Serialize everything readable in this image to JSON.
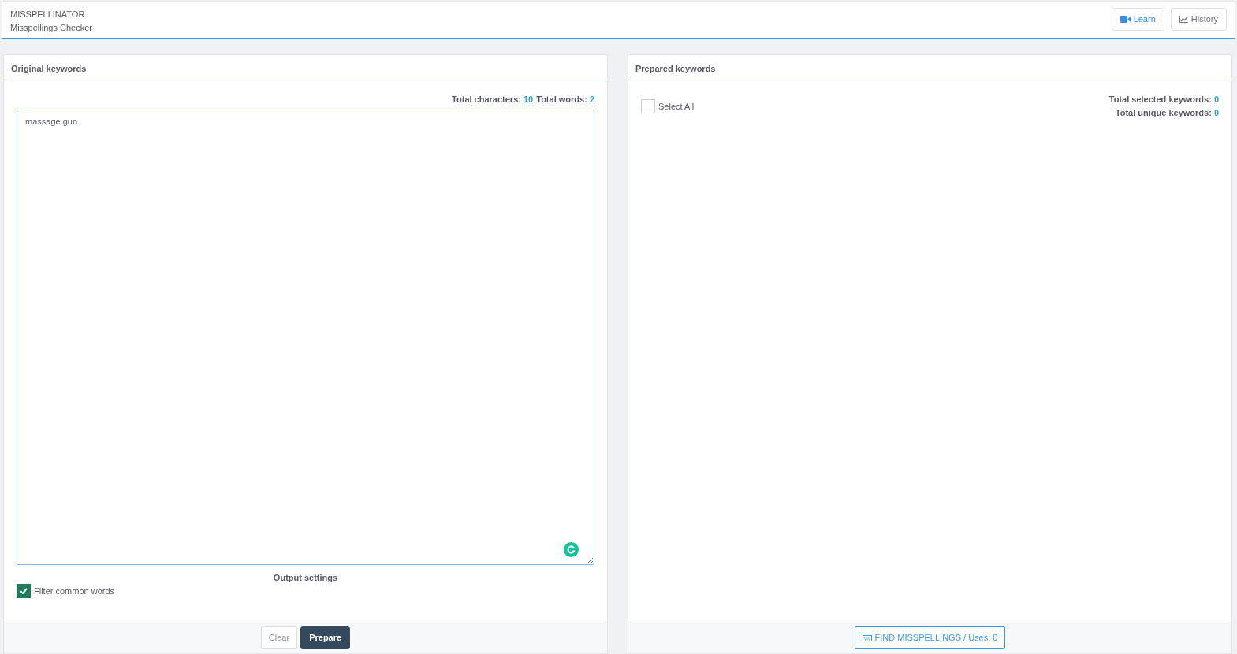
{
  "header": {
    "title": "MISSPELLINATOR",
    "subtitle": "Misspellings Checker",
    "buttons": [
      {
        "kind": "video",
        "label": "Learn"
      },
      {
        "kind": "chart",
        "label": "History"
      }
    ]
  },
  "original_panel": {
    "title": "Original keywords",
    "stats": [
      {
        "label": "Total characters:",
        "value": "10"
      },
      {
        "label": "Total words:",
        "value": "2"
      }
    ],
    "text_value": "massage gun",
    "output_settings_label": "Output settings",
    "options": [
      {
        "label": "Filter common words",
        "checked": true
      }
    ],
    "buttons": [
      {
        "kind": "secondary",
        "label": "Clear"
      },
      {
        "kind": "primary",
        "label": "Prepare"
      }
    ]
  },
  "prepared_panel": {
    "title": "Prepared keywords",
    "select_all": {
      "label": "Select All",
      "checked": false
    },
    "stats": [
      {
        "label": "Total selected keywords:",
        "value": "0"
      },
      {
        "label": "Total unique keywords:",
        "value": "0"
      }
    ],
    "action_button": {
      "label": "FIND MISSPELLINGS / Uses: 0"
    }
  }
}
